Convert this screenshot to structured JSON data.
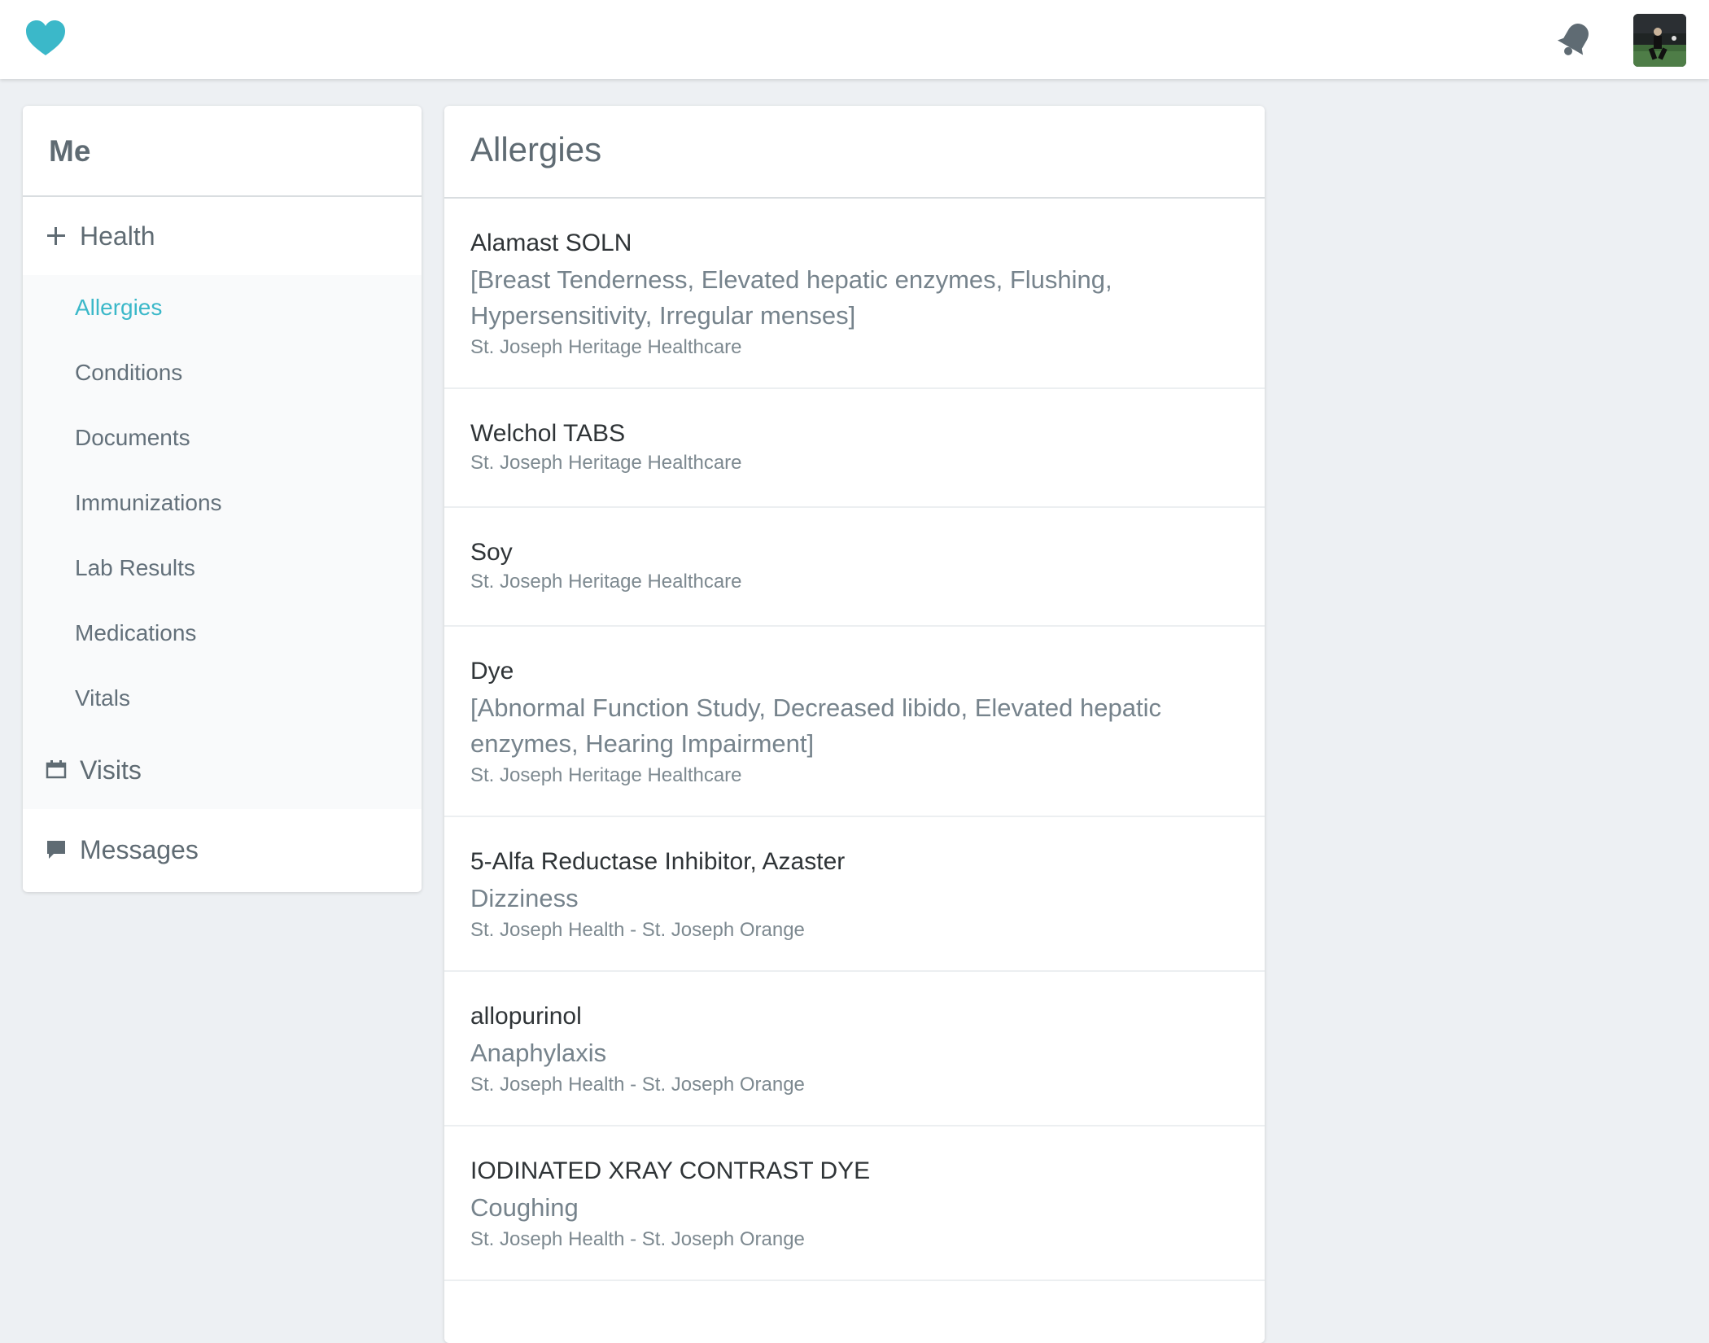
{
  "colors": {
    "accent": "#3bb8c9",
    "background": "#edf0f3",
    "text": "#5f6b73",
    "icon": "#5f6b73"
  },
  "header": {
    "logo_icon": "heart-icon",
    "notifications_icon": "bell-icon",
    "avatar_icon": "user-avatar"
  },
  "sidebar": {
    "title": "Me",
    "health": {
      "icon": "plus-icon",
      "label": "Health"
    },
    "items": [
      {
        "label": "Allergies",
        "active": true
      },
      {
        "label": "Conditions",
        "active": false
      },
      {
        "label": "Documents",
        "active": false
      },
      {
        "label": "Immunizations",
        "active": false
      },
      {
        "label": "Lab Results",
        "active": false
      },
      {
        "label": "Medications",
        "active": false
      },
      {
        "label": "Vitals",
        "active": false
      }
    ],
    "visits": {
      "icon": "calendar-icon",
      "label": "Visits"
    },
    "messages": {
      "icon": "chat-bubble-icon",
      "label": "Messages"
    }
  },
  "main": {
    "title": "Allergies",
    "allergies": [
      {
        "name": "Alamast SOLN",
        "reaction": "[Breast Tenderness, Elevated hepatic enzymes, Flushing, Hypersensitivity, Irregular menses]",
        "source": "St. Joseph Heritage Healthcare"
      },
      {
        "name": "Welchol TABS",
        "reaction": "",
        "source": "St. Joseph Heritage Healthcare"
      },
      {
        "name": "Soy",
        "reaction": "",
        "source": "St. Joseph Heritage Healthcare"
      },
      {
        "name": "Dye",
        "reaction": "[Abnormal Function Study, Decreased libido, Elevated hepatic enzymes, Hearing Impairment]",
        "source": "St. Joseph Heritage Healthcare"
      },
      {
        "name": "5-Alfa Reductase Inhibitor, Azaster",
        "reaction": "Dizziness",
        "source": "St. Joseph Health - St. Joseph Orange"
      },
      {
        "name": "allopurinol",
        "reaction": "Anaphylaxis",
        "source": "St. Joseph Health - St. Joseph Orange"
      },
      {
        "name": "IODINATED XRAY CONTRAST DYE",
        "reaction": "Coughing",
        "source": "St. Joseph Health - St. Joseph Orange"
      }
    ]
  }
}
